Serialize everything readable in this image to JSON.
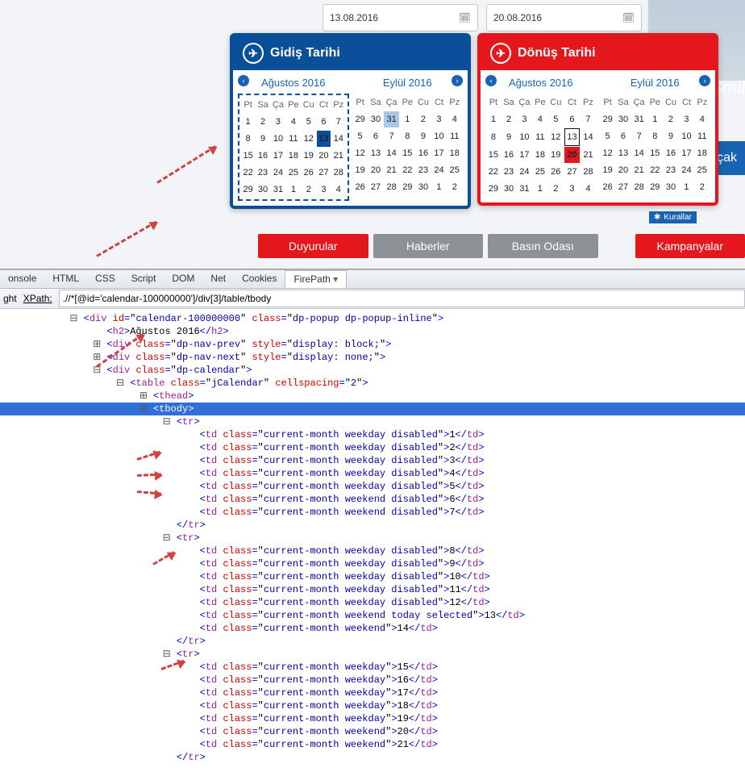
{
  "inputs": {
    "depart": "13.08.2016",
    "return": "20.08.2016"
  },
  "cal": {
    "departTitle": "Gidiş Tarihi",
    "returnTitle": "Dönüş Tarihi",
    "month1": "Ağustos 2016",
    "month2": "Eylül 2016",
    "dow": [
      "Pt",
      "Sa",
      "Ça",
      "Pe",
      "Cu",
      "Ct",
      "Pz"
    ],
    "selDepart": 13,
    "selReturn": 20
  },
  "tabs": {
    "t1": "Duyurular",
    "t2": "Haberler",
    "t3": "Basın Odası",
    "t4": "Kampanyalar"
  },
  "side": {
    "ucak": "Uçak",
    "kurallar": "Kurallar",
    "smile": "Smil"
  },
  "fb": {
    "tabs": [
      "onsole",
      "HTML",
      "CSS",
      "Script",
      "DOM",
      "Net",
      "Cookies",
      "FirePath"
    ],
    "row2_btn1": "ght",
    "row2_label": "XPath:",
    "xpath": ".//*[@id='calendar-100000000']/div[3]/table/tbody",
    "h2": "Ağustos 2016"
  },
  "dom": {
    "calId": "calendar-100000000",
    "popupClass": "dp-popup dp-popup-inline",
    "navPrev": "display: block;",
    "navNext": "display: none;",
    "tableClass": "jCalendar",
    "spacing": "2",
    "rows": [
      [
        {
          "cls": "current-month weekday disabled",
          "v": "1"
        },
        {
          "cls": "current-month weekday disabled",
          "v": "2"
        },
        {
          "cls": "current-month weekday disabled",
          "v": "3"
        },
        {
          "cls": "current-month weekday disabled",
          "v": "4"
        },
        {
          "cls": "current-month weekday disabled",
          "v": "5"
        },
        {
          "cls": "current-month weekend disabled",
          "v": "6"
        },
        {
          "cls": "current-month weekend disabled",
          "v": "7"
        }
      ],
      [
        {
          "cls": "current-month weekday disabled",
          "v": "8"
        },
        {
          "cls": "current-month weekday disabled",
          "v": "9"
        },
        {
          "cls": "current-month weekday disabled",
          "v": "10"
        },
        {
          "cls": "current-month weekday disabled",
          "v": "11"
        },
        {
          "cls": "current-month weekday disabled",
          "v": "12"
        },
        {
          "cls": "current-month weekend today selected",
          "v": "13"
        },
        {
          "cls": "current-month weekend",
          "v": "14"
        }
      ],
      [
        {
          "cls": "current-month weekday",
          "v": "15"
        },
        {
          "cls": "current-month weekday",
          "v": "16"
        },
        {
          "cls": "current-month weekday",
          "v": "17"
        },
        {
          "cls": "current-month weekday",
          "v": "18"
        },
        {
          "cls": "current-month weekday",
          "v": "19"
        },
        {
          "cls": "current-month weekend",
          "v": "20"
        },
        {
          "cls": "current-month weekend",
          "v": "21"
        }
      ]
    ]
  }
}
